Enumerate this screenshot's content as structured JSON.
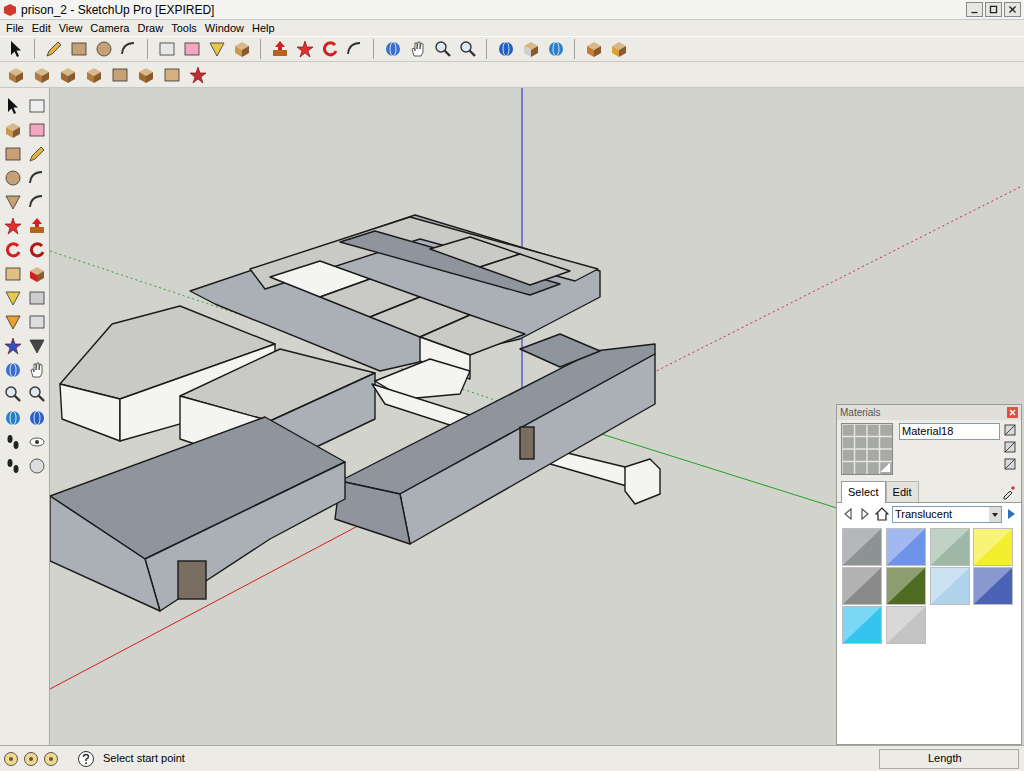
{
  "window": {
    "title": "prison_2 - SketchUp Pro [EXPIRED]"
  },
  "menu": [
    "File",
    "Edit",
    "View",
    "Camera",
    "Draw",
    "Tools",
    "Window",
    "Help"
  ],
  "materials": {
    "title": "Materials",
    "material_name": "Material18",
    "tabs": [
      {
        "label": "Select",
        "selected": true
      },
      {
        "label": "Edit",
        "selected": false
      }
    ],
    "collection": "Translucent",
    "swatches": [
      {
        "color": "#8d9293"
      },
      {
        "color": "#6f93e8"
      },
      {
        "color": "#9fb8a6"
      },
      {
        "color": "#f4ef2e"
      },
      {
        "color": "#8a8a8a"
      },
      {
        "color": "#4f6b22"
      },
      {
        "color": "#aed3ea"
      },
      {
        "color": "#4a63b5"
      },
      {
        "color": "#35c3ef"
      },
      {
        "color": "#c4c4c4"
      }
    ]
  },
  "status_bar": {
    "message": "Select start point",
    "measurement_label": "Length"
  }
}
